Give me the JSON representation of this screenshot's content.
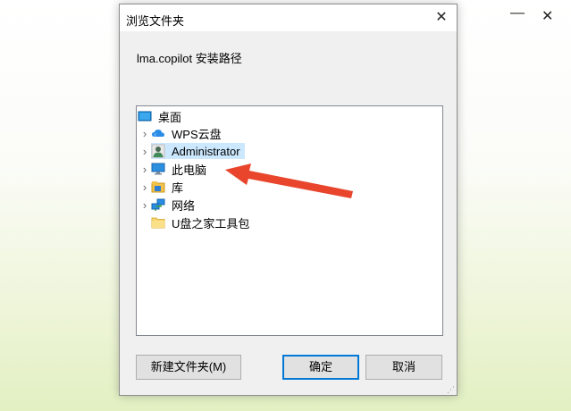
{
  "background": {
    "min_glyph": "—",
    "close_glyph": "✕"
  },
  "dialog": {
    "title": "浏览文件夹",
    "close_glyph": "✕",
    "prompt": "lma.copilot 安装路径",
    "tree": [
      {
        "label": "桌面",
        "icon": "desktop-icon",
        "expandable": false,
        "level": 0
      },
      {
        "label": "WPS云盘",
        "icon": "cloud-icon",
        "expandable": true,
        "level": 1
      },
      {
        "label": "Administrator",
        "icon": "user-icon",
        "expandable": true,
        "level": 1,
        "selected": true
      },
      {
        "label": "此电脑",
        "icon": "computer-icon",
        "expandable": true,
        "level": 1
      },
      {
        "label": "库",
        "icon": "library-icon",
        "expandable": true,
        "level": 1
      },
      {
        "label": "网络",
        "icon": "network-icon",
        "expandable": true,
        "level": 1
      },
      {
        "label": "U盘之家工具包",
        "icon": "folder-icon",
        "expandable": false,
        "level": 1
      }
    ],
    "buttons": {
      "new_folder": "新建文件夹(M)",
      "ok": "确定",
      "cancel": "取消"
    }
  },
  "annotation": {
    "arrow_color": "#e8452c"
  },
  "colors": {
    "selection": "#cce8ff",
    "accent": "#0078d7"
  }
}
